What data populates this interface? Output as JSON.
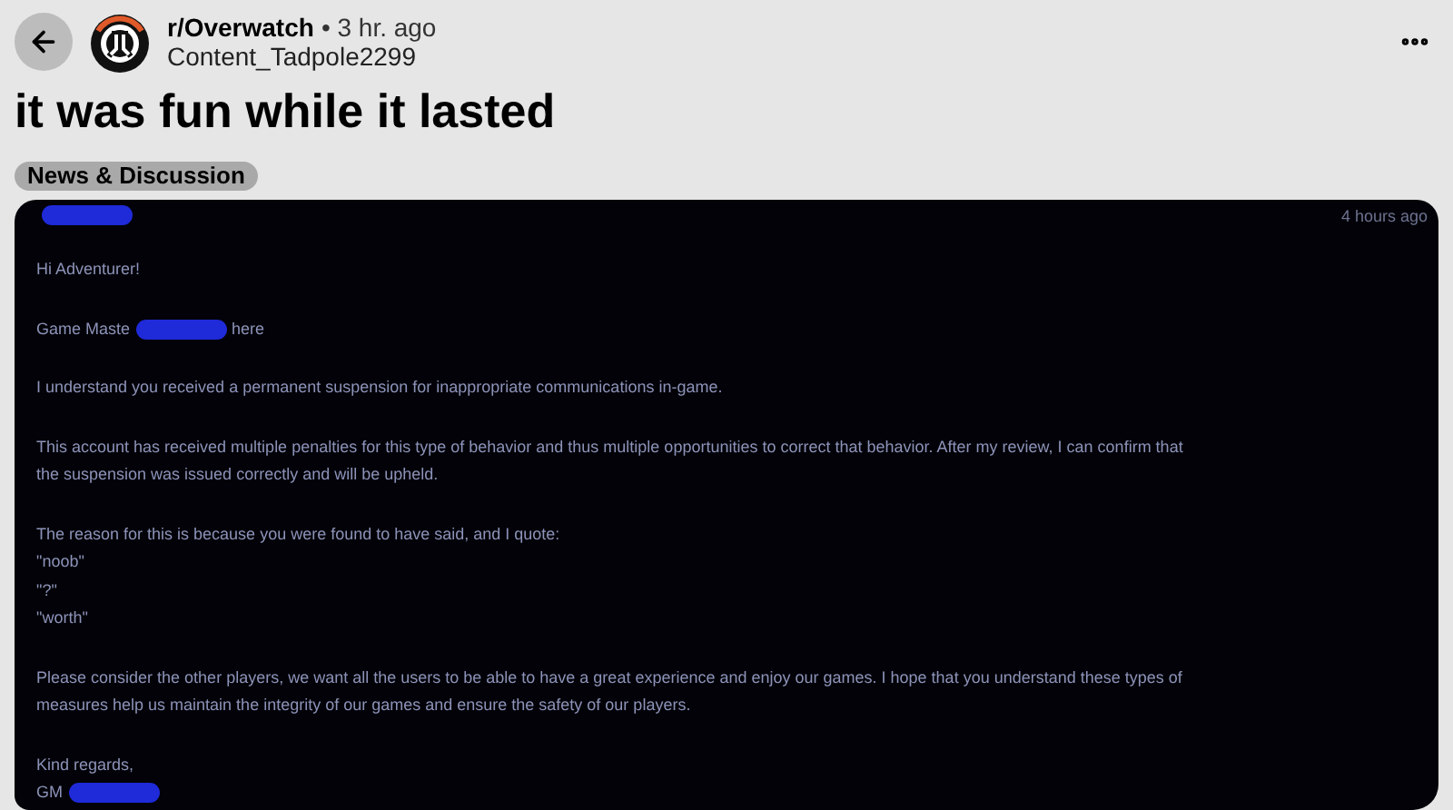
{
  "header": {
    "subreddit": "r/Overwatch",
    "time": "• 3 hr. ago",
    "author": "Content_Tadpole2299"
  },
  "post": {
    "title": "it was fun while it lasted",
    "flair": "News & Discussion"
  },
  "message": {
    "timestamp": "4 hours ago",
    "paragraphs": [
      {
        "lines": [
          [
            {
              "kind": "redaction"
            }
          ]
        ]
      },
      {
        "lines": [
          [
            {
              "kind": "text",
              "text": "Hi Adventurer!"
            }
          ]
        ]
      },
      {
        "lines": [
          [
            {
              "kind": "text",
              "text": "Game Maste"
            },
            {
              "kind": "redaction"
            },
            {
              "kind": "text",
              "text": "here"
            }
          ]
        ]
      },
      {
        "lines": [
          [
            {
              "kind": "text",
              "text": "I understand you received a permanent suspension for inappropriate communications in-game."
            }
          ]
        ]
      },
      {
        "lines": [
          [
            {
              "kind": "text",
              "text": "This account has received multiple penalties for this type of behavior and thus multiple opportunities to correct that behavior. After my review, I can confirm that"
            }
          ],
          [
            {
              "kind": "text",
              "text": "the suspension was issued correctly and will be upheld."
            }
          ]
        ]
      },
      {
        "lines": [
          [
            {
              "kind": "text",
              "text": "The reason for this is because you were found to have said, and I quote:"
            }
          ],
          [
            {
              "kind": "text",
              "text": "\"noob\""
            }
          ],
          [
            {
              "kind": "text",
              "text": "\"?\""
            }
          ],
          [
            {
              "kind": "text",
              "text": "\"worth\""
            }
          ]
        ]
      },
      {
        "lines": [
          [
            {
              "kind": "text",
              "text": "Please consider the other players, we want all the users to be able to have a great experience and enjoy our games. I hope that you understand these types of"
            }
          ],
          [
            {
              "kind": "text",
              "text": "measures help us maintain the integrity of our games and ensure the safety of our players."
            }
          ]
        ]
      },
      {
        "lines": [
          [
            {
              "kind": "text",
              "text": "Kind regards,"
            }
          ],
          [
            {
              "kind": "text",
              "text": "GM"
            },
            {
              "kind": "redaction"
            }
          ]
        ]
      }
    ]
  }
}
